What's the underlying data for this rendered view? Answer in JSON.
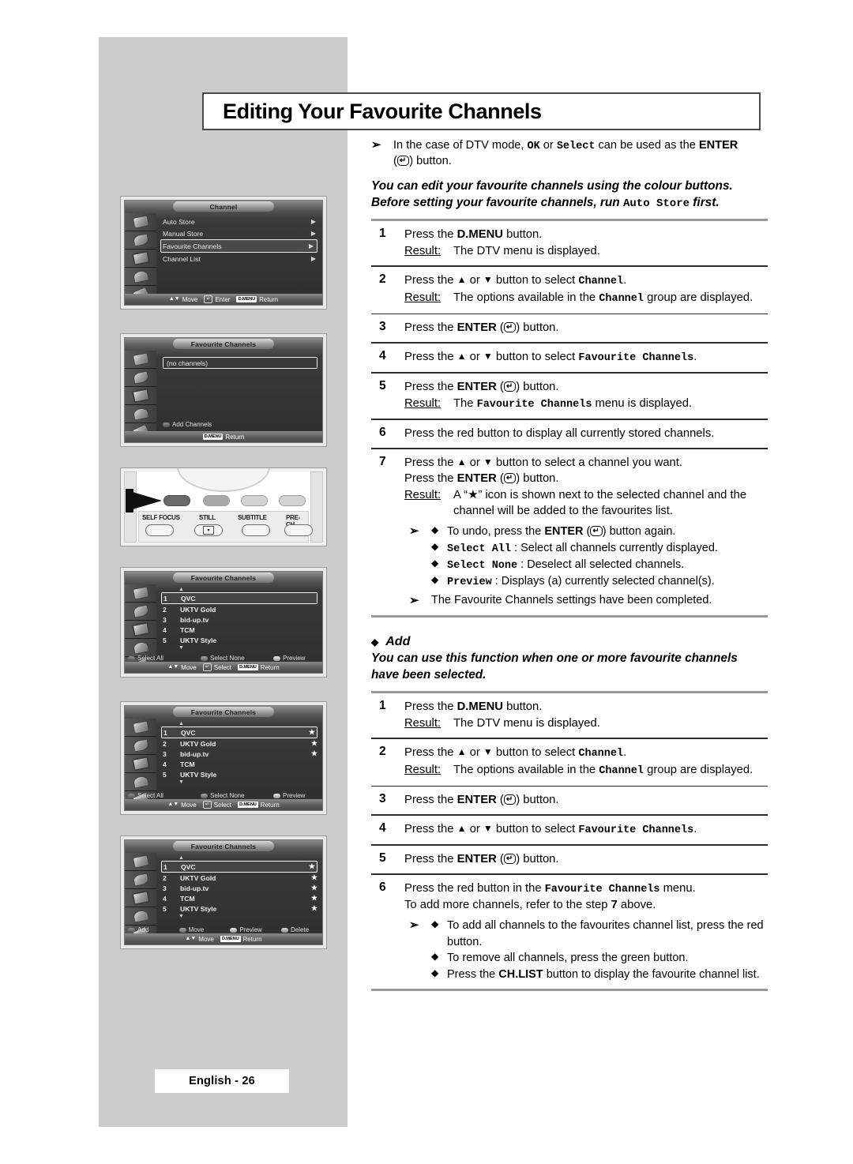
{
  "page": {
    "title": "Editing Your Favourite Channels",
    "footer": "English - 26"
  },
  "intro": {
    "note": {
      "arrow": "➢",
      "text_a": "In the case of DTV mode, ",
      "ok": "OK",
      "text_b": " or ",
      "select": "Select",
      "text_c": " can be used as the ",
      "enter": "ENTER",
      "text_d": " (",
      "enter_glyph": "↵",
      "text_e": ") button."
    },
    "italic_line1": "You can edit your favourite channels using the colour buttons.",
    "italic_line2_a": "Before setting your favourite channels, run ",
    "italic_line2_mono": "Auto Store",
    "italic_line2_b": " first."
  },
  "steps_main": [
    {
      "num": "1",
      "lines": [
        "Press the D.MENU button."
      ],
      "bold_tokens": [
        "D.MENU"
      ],
      "result_label": "Result:",
      "result_text": "The DTV menu is displayed."
    },
    {
      "num": "2",
      "line_a": "Press the ",
      "up": "▲",
      "line_b": " or ",
      "down": "▼",
      "line_c": " button to select ",
      "mono": "Channel",
      "line_d": ".",
      "result_label": "Result:",
      "result_a": "The options available in the ",
      "result_mono": "Channel",
      "result_b": " group are displayed."
    },
    {
      "num": "3",
      "line_a": "Press the ",
      "enter": "ENTER",
      "line_b": " (",
      "glyph": "↵",
      "line_c": ") button."
    },
    {
      "num": "4",
      "line_a": "Press the ",
      "up": "▲",
      "line_b": " or ",
      "down": "▼",
      "line_c": " button to select ",
      "mono": "Favourite Channels",
      "line_d": "."
    },
    {
      "num": "5",
      "line_a": "Press the ",
      "enter": "ENTER",
      "line_b": " (",
      "glyph": "↵",
      "line_c": ") button.",
      "result_label": "Result:",
      "result_a": "The ",
      "result_mono": "Favourite Channels",
      "result_b": " menu is displayed."
    },
    {
      "num": "6",
      "line_a": "Press the red button to display all currently stored channels."
    },
    {
      "num": "7",
      "line_a": "Press the ",
      "up": "▲",
      "line_b": " or ",
      "down": "▼",
      "line_c": " button to select a channel you want.",
      "line2_a": "Press the ",
      "enter": "ENTER",
      "line2_b": " (",
      "glyph": "↵",
      "line2_c": ") button.",
      "result_label": "Result:",
      "result_a": "A “★” icon is shown next to the selected channel and the channel will be added to the favourites list.",
      "subnote_arrow": "➢",
      "bullets": [
        {
          "dot": "◆",
          "a": "To undo, press the ",
          "bold": "ENTER",
          "b": " (",
          "glyph": "↵",
          "c": ") button again."
        },
        {
          "dot": "◆",
          "mono": "Select All",
          "tail": " : Select all channels currently displayed."
        },
        {
          "dot": "◆",
          "mono": "Select None",
          "tail": " : Deselect all selected channels."
        },
        {
          "dot": "◆",
          "mono": "Preview",
          "tail": " : Displays (a) currently selected channel(s)."
        }
      ],
      "closing_arrow": "➢",
      "closing_text": "The Favourite Channels settings have been completed."
    }
  ],
  "add_section": {
    "dot": "◆",
    "title": "Add",
    "subtitle": "You can use this function when one or more favourite channels have been selected.",
    "steps": [
      {
        "num": "1",
        "line_a": "Press the ",
        "bold": "D.MENU",
        "line_b": " button.",
        "result_label": "Result:",
        "result_text": "The DTV menu is displayed."
      },
      {
        "num": "2",
        "line_a": "Press the ",
        "up": "▲",
        "line_b": " or ",
        "down": "▼",
        "line_c": " button to select ",
        "mono": "Channel",
        "line_d": ".",
        "result_label": "Result:",
        "result_a": "The options available in the ",
        "result_mono": "Channel",
        "result_b": " group are displayed."
      },
      {
        "num": "3",
        "line_a": "Press the ",
        "enter": "ENTER",
        "line_b": " (",
        "glyph": "↵",
        "line_c": ") button."
      },
      {
        "num": "4",
        "line_a": "Press the ",
        "up": "▲",
        "line_b": " or ",
        "down": "▼",
        "line_c": " button to select ",
        "mono": "Favourite Channels",
        "line_d": "."
      },
      {
        "num": "5",
        "line_a": "Press the ",
        "enter": "ENTER",
        "line_b": " (",
        "glyph": "↵",
        "line_c": ") button."
      },
      {
        "num": "6",
        "line_a": "Press the red button in the ",
        "mono": "Favourite Channels",
        "line_b": " menu.",
        "line2_a": "To add more channels, refer to the step ",
        "line2_bold": "7",
        "line2_b": " above.",
        "subnote_arrow": "➢",
        "bullets": [
          {
            "dot": "◆",
            "text": "To add all channels to the favourites channel list, press the red button."
          },
          {
            "dot": "◆",
            "text": "To remove all channels, press the green button."
          },
          {
            "dot": "◆",
            "a": "Press the ",
            "bold": "CH.LIST",
            "b": " button to display the favourite channel list."
          }
        ]
      }
    ]
  },
  "screenshots": {
    "shot1": {
      "tab": "Channel",
      "rows": [
        {
          "label": "Auto Store",
          "arrow": "▶",
          "selected": false
        },
        {
          "label": "Manual Store",
          "arrow": "▶",
          "selected": false
        },
        {
          "label": "Favourite Channels",
          "arrow": "▶",
          "selected": true
        },
        {
          "label": "Channel List",
          "arrow": "▶",
          "selected": false
        }
      ],
      "bottom": [
        {
          "glyph": "▲▼",
          "label": "Move"
        },
        {
          "glyph": "↵",
          "label": "Enter"
        },
        {
          "glyph": "D.MENU",
          "label": "Return"
        }
      ]
    },
    "shot2": {
      "tab": "Favourite Channels",
      "empty_label": "(no channels)",
      "add_label": "Add Channels",
      "bottom": [
        {
          "glyph": "D.MENU",
          "label": "Return"
        }
      ]
    },
    "shot3": {
      "tab": "Favourite Channels",
      "channels": [
        {
          "no": "1",
          "name": "QVC",
          "star": "",
          "selected": true
        },
        {
          "no": "2",
          "name": "UKTV Gold",
          "star": "",
          "selected": false
        },
        {
          "no": "3",
          "name": "bid-up.tv",
          "star": "",
          "selected": false
        },
        {
          "no": "4",
          "name": "TCM",
          "star": "",
          "selected": false
        },
        {
          "no": "5",
          "name": "UKTV Style",
          "star": "",
          "selected": false
        }
      ],
      "colors": [
        {
          "key": "red",
          "label": "Select All"
        },
        {
          "key": "green",
          "label": "Select None"
        },
        {
          "key": "yellow",
          "label": "Preview"
        }
      ],
      "bottom": [
        {
          "glyph": "▲▼",
          "label": "Move"
        },
        {
          "glyph": "↵",
          "label": "Select"
        },
        {
          "glyph": "D.MENU",
          "label": "Return"
        }
      ]
    },
    "shot4": {
      "tab": "Favourite Channels",
      "channels": [
        {
          "no": "1",
          "name": "QVC",
          "star": "★",
          "selected": true
        },
        {
          "no": "2",
          "name": "UKTV Gold",
          "star": "★",
          "selected": false
        },
        {
          "no": "3",
          "name": "bid-up.tv",
          "star": "★",
          "selected": false
        },
        {
          "no": "4",
          "name": "TCM",
          "star": "",
          "selected": false
        },
        {
          "no": "5",
          "name": "UKTV Style",
          "star": "",
          "selected": false
        }
      ],
      "colors": [
        {
          "key": "red",
          "label": "Select All"
        },
        {
          "key": "green",
          "label": "Select None"
        },
        {
          "key": "yellow",
          "label": "Preview"
        }
      ],
      "bottom": [
        {
          "glyph": "▲▼",
          "label": "Move"
        },
        {
          "glyph": "↵",
          "label": "Select"
        },
        {
          "glyph": "D.MENU",
          "label": "Return"
        }
      ]
    },
    "shot5": {
      "tab": "Favourite Channels",
      "channels": [
        {
          "no": "1",
          "name": "QVC",
          "star": "★",
          "selected": true
        },
        {
          "no": "2",
          "name": "UKTV Gold",
          "star": "★",
          "selected": false
        },
        {
          "no": "3",
          "name": "bid-up.tv",
          "star": "★",
          "selected": false
        },
        {
          "no": "4",
          "name": "TCM",
          "star": "★",
          "selected": false
        },
        {
          "no": "5",
          "name": "UKTV Style",
          "star": "★",
          "selected": false
        }
      ],
      "colors": [
        {
          "key": "red",
          "label": "Add"
        },
        {
          "key": "green",
          "label": "Move"
        },
        {
          "key": "yellow",
          "label": "Preview"
        },
        {
          "key": "blue",
          "label": "Delete"
        }
      ],
      "bottom": [
        {
          "glyph": "▲▼",
          "label": "Move"
        },
        {
          "glyph": "D.MENU",
          "label": "Return"
        }
      ]
    },
    "remote": {
      "labels": [
        "SELF FOCUS",
        "STILL",
        "SUBTITLE",
        "PRE-CH"
      ],
      "still_glyph": "▾"
    }
  }
}
